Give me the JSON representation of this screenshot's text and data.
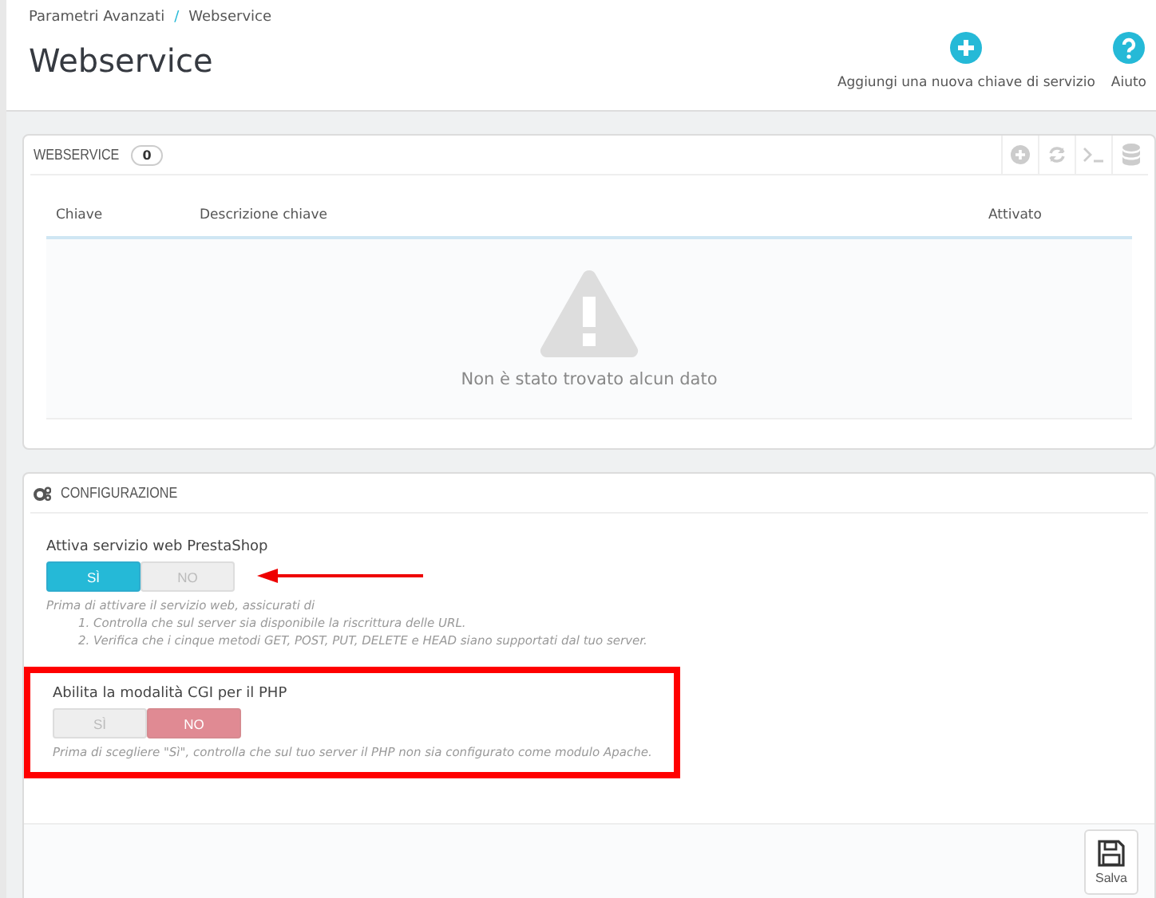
{
  "breadcrumb": [
    "Parametri Avanzati",
    "Webservice"
  ],
  "breadcrumb_separator": "/",
  "page_title": "Webservice",
  "toolbar": [
    {
      "kind": "add",
      "label": "Aggiungi una nuova chiave di servizio"
    },
    {
      "kind": "help",
      "label": "Aiuto"
    }
  ],
  "webservice_panel": {
    "title": "WEBSERVICE",
    "count": "0",
    "actions": [
      {
        "kind": "add"
      },
      {
        "kind": "refresh"
      },
      {
        "kind": "terminal"
      },
      {
        "kind": "database"
      }
    ],
    "columns": [
      "Chiave",
      "Descrizione chiave",
      "Attivato"
    ],
    "empty_message": "Non è stato trovato alcun dato"
  },
  "config_panel": {
    "title": "CONFIGURAZIONE",
    "settings": [
      {
        "label": "Attiva servizio web PrestaShop",
        "kind": "arrow",
        "options": [
          {
            "label": "SÌ",
            "kind": "yes",
            "selected": true
          },
          {
            "label": "NO",
            "kind": "no",
            "selected": false
          }
        ],
        "help": "Prima di attivare il servizio web, assicurati di",
        "help_items": [
          "1. Controlla che sul server sia disponibile la riscrittura delle URL.",
          "2. Verifica che i cinque metodi GET, POST, PUT, DELETE e HEAD siano supportati dal tuo server."
        ]
      },
      {
        "label": "Abilita la modalità CGI per il PHP",
        "kind": "box",
        "options": [
          {
            "label": "SÌ",
            "kind": "yes",
            "selected": false
          },
          {
            "label": "NO",
            "kind": "no",
            "selected": true
          }
        ],
        "help": "Prima di scegliere \"Sì\", controlla che sul tuo server il PHP non sia configurato come modulo Apache."
      }
    ],
    "save_label": "Salva"
  }
}
